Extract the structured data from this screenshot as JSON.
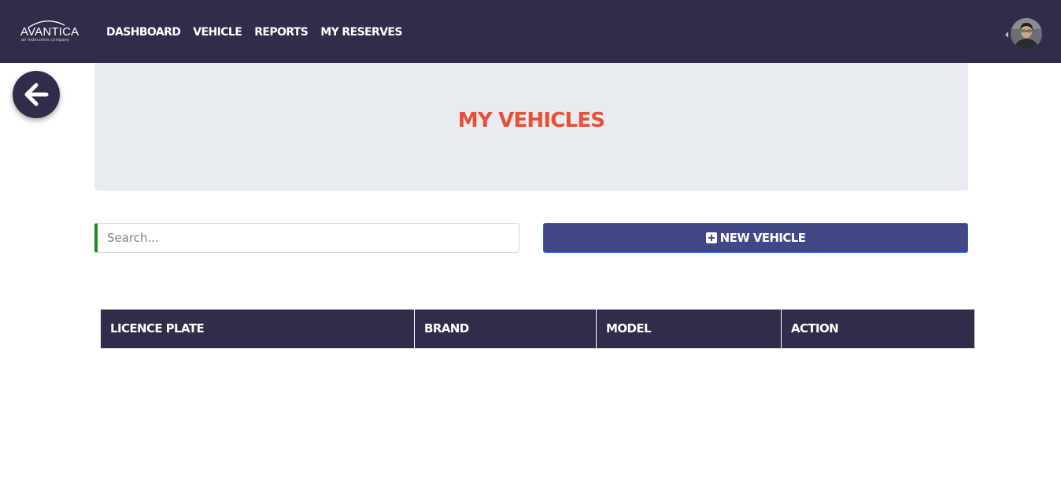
{
  "brand": {
    "name": "AVANTICA",
    "tagline": "an Indecomm company"
  },
  "nav": {
    "items": [
      {
        "label": "DASHBOARD"
      },
      {
        "label": "VEHICLE"
      },
      {
        "label": "REPORTS"
      },
      {
        "label": "MY RESERVES"
      }
    ]
  },
  "page": {
    "title": "MY VEHICLES"
  },
  "search": {
    "placeholder": "Search...",
    "value": ""
  },
  "toolbar": {
    "new_vehicle_label": "NEW VEHICLE"
  },
  "table": {
    "columns": [
      "LICENCE PLATE",
      "BRAND",
      "MODEL",
      "ACTION"
    ],
    "rows": []
  },
  "icons": {
    "back": "arrow-left-icon",
    "add": "plus-square-icon",
    "user_menu": "caret-left-icon"
  },
  "colors": {
    "navbar": "#302d4a",
    "title": "#e84f36",
    "hero_bg": "#e8ebef",
    "primary_button": "#424886",
    "search_accent": "#1d8a1d"
  }
}
